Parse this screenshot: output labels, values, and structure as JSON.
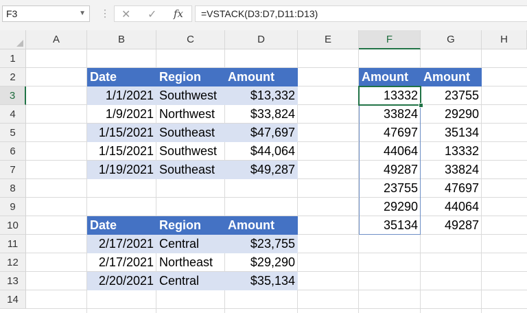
{
  "formula_bar": {
    "name_box": "F3",
    "cancel_icon": "✕",
    "enter_icon": "✓",
    "fx_label": "fx",
    "formula": "=VSTACK(D3:D7,D11:D13)"
  },
  "columns": [
    "A",
    "B",
    "C",
    "D",
    "E",
    "F",
    "G",
    "H"
  ],
  "rows": [
    "1",
    "2",
    "3",
    "4",
    "5",
    "6",
    "7",
    "8",
    "9",
    "10",
    "11",
    "12",
    "13",
    "14"
  ],
  "table1": {
    "headers": [
      "Date",
      "Region",
      "Amount"
    ],
    "rows": [
      [
        "1/1/2021",
        "Southwest",
        "$13,332"
      ],
      [
        "1/9/2021",
        "Northwest",
        "$33,824"
      ],
      [
        "1/15/2021",
        "Southeast",
        "$47,697"
      ],
      [
        "1/15/2021",
        "Southwest",
        "$44,064"
      ],
      [
        "1/19/2021",
        "Southeast",
        "$49,287"
      ]
    ]
  },
  "table2": {
    "headers": [
      "Date",
      "Region",
      "Amount"
    ],
    "rows": [
      [
        "2/17/2021",
        "Central",
        "$23,755"
      ],
      [
        "2/17/2021",
        "Northeast",
        "$29,290"
      ],
      [
        "2/20/2021",
        "Central",
        "$35,134"
      ]
    ]
  },
  "result": {
    "headers": [
      "Amount",
      "Amount"
    ],
    "col_f": [
      "13332",
      "33824",
      "47697",
      "44064",
      "49287",
      "23755",
      "29290",
      "35134"
    ],
    "col_g": [
      "23755",
      "29290",
      "35134",
      "13332",
      "33824",
      "47697",
      "44064",
      "49287"
    ]
  },
  "colors": {
    "table_header": "#4472c4",
    "band": "#d9e1f2",
    "selection": "#217346"
  }
}
